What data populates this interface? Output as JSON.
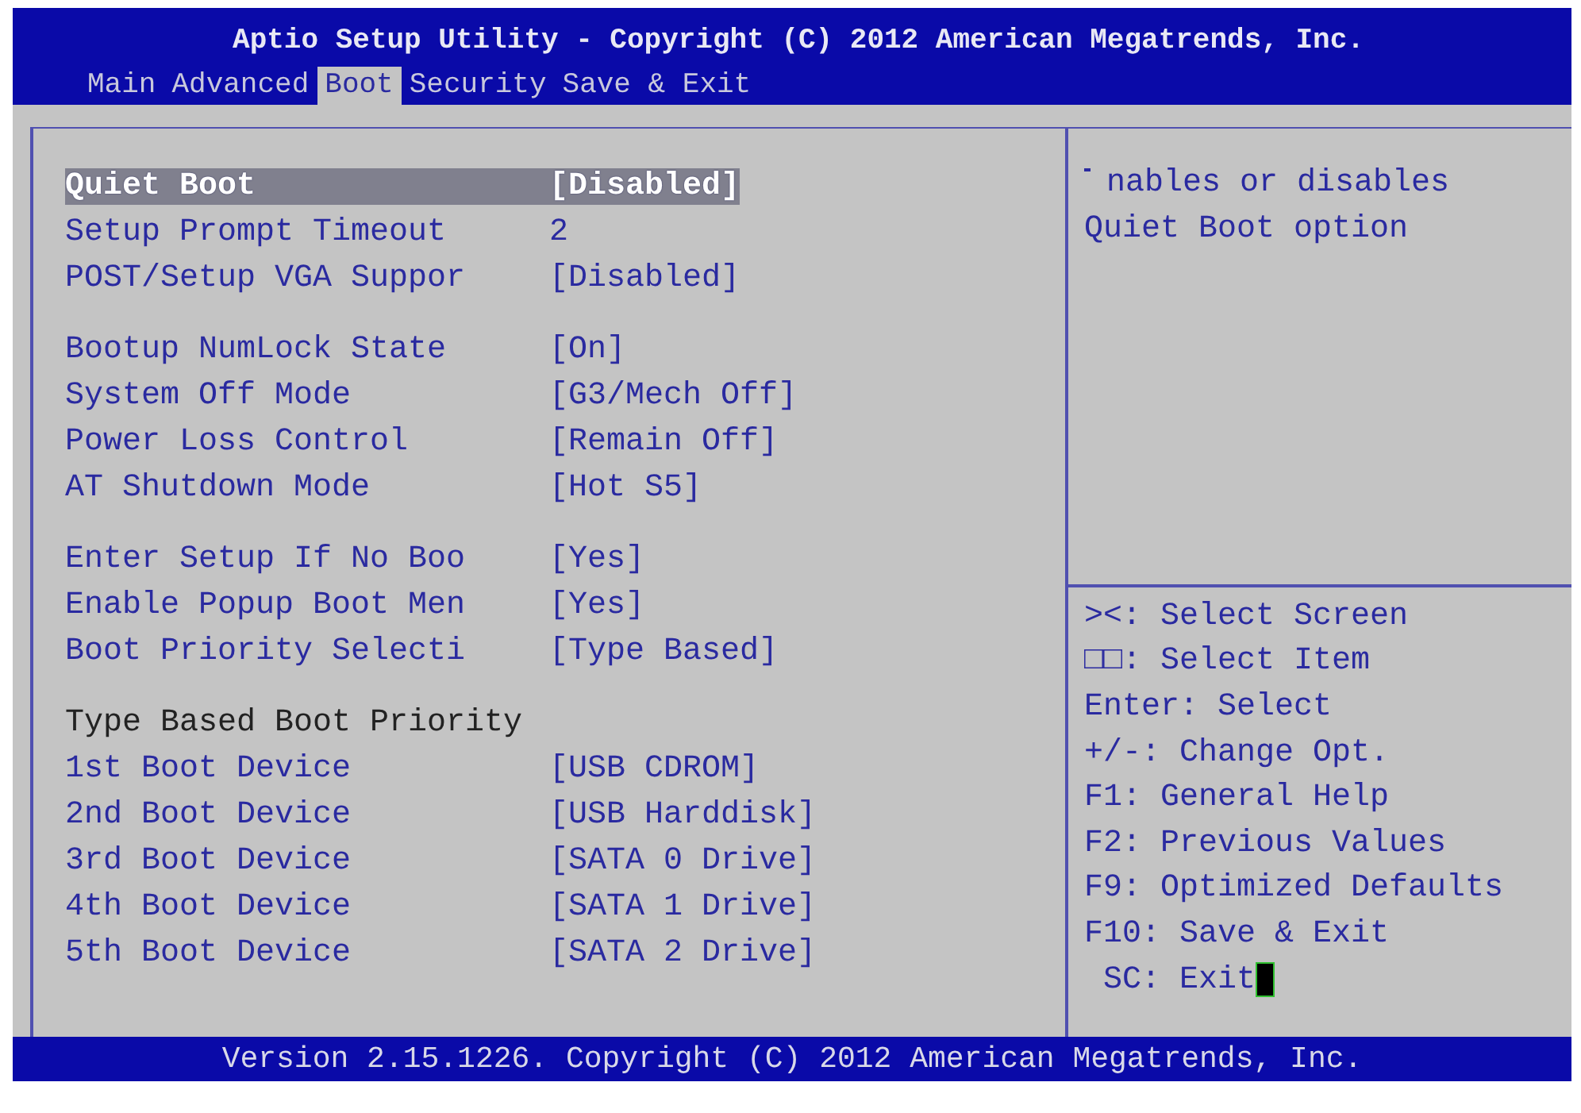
{
  "title": "Aptio Setup Utility - Copyright (C) 2012 American Megatrends, Inc.",
  "tabs": [
    {
      "label": "Main",
      "selected": false
    },
    {
      "label": "Advanced",
      "selected": false
    },
    {
      "label": "Boot",
      "selected": true
    },
    {
      "label": "Security",
      "selected": false
    },
    {
      "label": "Save & Exit",
      "selected": false
    }
  ],
  "settings": [
    [
      {
        "kind": "setting",
        "label": "Quiet Boot",
        "value": "[Disabled]",
        "selected": true
      },
      {
        "kind": "setting",
        "label": "Setup Prompt Timeout",
        "value": "2",
        "selected": false
      },
      {
        "kind": "setting",
        "label": "POST/Setup VGA Suppor",
        "value": "[Disabled]",
        "selected": false
      }
    ],
    [
      {
        "kind": "setting",
        "label": "Bootup NumLock State",
        "value": "[On]",
        "selected": false
      },
      {
        "kind": "setting",
        "label": "System Off Mode",
        "value": "[G3/Mech Off]",
        "selected": false
      },
      {
        "kind": "setting",
        "label": "Power Loss Control",
        "value": "[Remain Off]",
        "selected": false
      },
      {
        "kind": "setting",
        "label": "AT Shutdown Mode",
        "value": "[Hot S5]",
        "selected": false
      }
    ],
    [
      {
        "kind": "setting",
        "label": "Enter Setup If No Boo",
        "value": "[Yes]",
        "selected": false
      },
      {
        "kind": "setting",
        "label": "Enable Popup Boot Men",
        "value": "[Yes]",
        "selected": false
      },
      {
        "kind": "setting",
        "label": "Boot Priority Selecti",
        "value": "[Type Based]",
        "selected": false
      }
    ],
    [
      {
        "kind": "heading",
        "label": "Type Based Boot Priority"
      },
      {
        "kind": "setting",
        "label": "1st Boot Device",
        "value": "[USB CDROM]",
        "selected": false
      },
      {
        "kind": "setting",
        "label": "2nd Boot Device",
        "value": "[USB Harddisk]",
        "selected": false
      },
      {
        "kind": "setting",
        "label": "3rd Boot Device",
        "value": "[SATA 0 Drive]",
        "selected": false
      },
      {
        "kind": "setting",
        "label": "4th Boot Device",
        "value": "[SATA 1 Drive]",
        "selected": false
      },
      {
        "kind": "setting",
        "label": "5th Boot Device",
        "value": "[SATA 2 Drive]",
        "selected": false
      }
    ]
  ],
  "help": [
    "nables or disables",
    "Quiet Boot option"
  ],
  "keys": [
    "><: Select Screen",
    "□□: Select Item",
    "Enter: Select",
    "+/-: Change Opt.",
    "F1: General Help",
    "F2: Previous Values",
    "F9: Optimized Defaults",
    "F10: Save & Exit",
    "SC: Exit"
  ],
  "footer": "Version 2.15.1226. Copyright (C) 2012 American Megatrends, Inc."
}
